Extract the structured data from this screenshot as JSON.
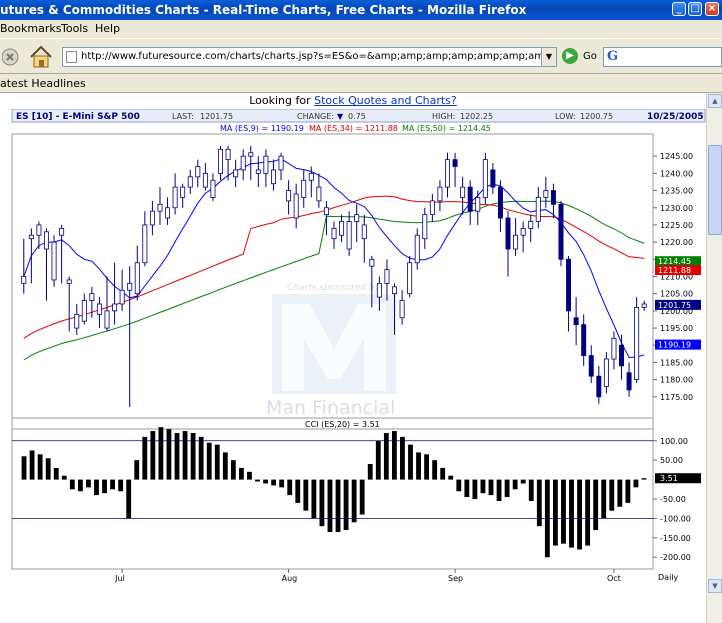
{
  "window": {
    "title": "utures & Commodities Charts - Real-Time Charts, Free Charts - Mozilla Firefox",
    "minimize": "_",
    "maximize": "□",
    "close": "×"
  },
  "menu": {
    "items": [
      "Bookmarks",
      "Tools",
      "Help"
    ]
  },
  "toolbar": {
    "url": "http://www.futuresource.com/charts/charts.jsp?s=ES&o=&amp;amp;amp;amp;amp;amp;amp;amp;a=D&",
    "go_label": "Go",
    "search_logo": "G"
  },
  "headlines": {
    "label": "atest Headlines"
  },
  "promo": {
    "prefix": "Looking for ",
    "link": "Stock Quotes and Charts?"
  },
  "chart_header": {
    "symbol": "ES [10] - E-Mini S&P 500",
    "last_label": "LAST:",
    "last": "1201.75",
    "change_label": "CHANGE:",
    "change": "0.75",
    "high_label": "HIGH:",
    "high": "1202.25",
    "low_label": "LOW:",
    "low": "1200.75",
    "date": "10/25/2005",
    "ma9_label": "MA (ES,9) = 1190.19",
    "ma34_label": "MA (ES,34) = 1211.88",
    "ma50_label": "MA (ES,50) = 1214.45",
    "cci_label": "CCI (ES,20) = 3.51",
    "sponsor": "Charts sponsored by",
    "watermark": "Man Financial",
    "period": "Daily"
  },
  "chart_data": [
    {
      "type": "candlestick",
      "title": "ES [10] - E-Mini S&P 500",
      "ylim": [
        1170,
        1250
      ],
      "y_ticks": [
        "1245.00",
        "1240.00",
        "1235.00",
        "1230.00",
        "1225.00",
        "1220.00",
        "1215.00",
        "1210.00",
        "1205.00",
        "1200.00",
        "1195.00",
        "1190.00",
        "1185.00",
        "1180.00",
        "1175.00"
      ],
      "x_labels": [
        "Jul",
        "Aug",
        "Sep",
        "Oct"
      ],
      "x_label_index": [
        13,
        35,
        57,
        78
      ],
      "value_tags": [
        {
          "value": "1214.45",
          "y": 1214.45,
          "color": "#008000"
        },
        {
          "value": "1211.88",
          "y": 1211.88,
          "color": "#e00000"
        },
        {
          "value": "1201.75",
          "y": 1201.75,
          "color": "#000080"
        },
        {
          "value": "1190.19",
          "y": 1190.19,
          "color": "#0000ff"
        }
      ],
      "candles": [
        [
          1208,
          1210,
          1205,
          1221
        ],
        [
          1221,
          1222,
          1208,
          1224
        ],
        [
          1222,
          1225,
          1218,
          1226
        ],
        [
          1218,
          1223,
          1203,
          1224
        ],
        [
          1209,
          1220,
          1207,
          1222
        ],
        [
          1222,
          1224,
          1208,
          1225
        ],
        [
          1208,
          1209,
          1194,
          1210
        ],
        [
          1195,
          1199,
          1193,
          1202
        ],
        [
          1197,
          1203,
          1196,
          1205
        ],
        [
          1203,
          1205,
          1198,
          1207
        ],
        [
          1199,
          1202,
          1195,
          1204
        ],
        [
          1195,
          1200,
          1194,
          1210
        ],
        [
          1200,
          1202,
          1196,
          1214
        ],
        [
          1202,
          1206,
          1200,
          1212
        ],
        [
          1206,
          1208,
          1172,
          1213
        ],
        [
          1205,
          1214,
          1203,
          1219
        ],
        [
          1214,
          1225,
          1213,
          1229
        ],
        [
          1225,
          1229,
          1222,
          1232
        ],
        [
          1229,
          1231,
          1225,
          1236
        ],
        [
          1227,
          1230,
          1225,
          1233
        ],
        [
          1230,
          1236,
          1228,
          1240
        ],
        [
          1233,
          1236,
          1230,
          1237
        ],
        [
          1236,
          1239,
          1234,
          1241
        ],
        [
          1239,
          1242,
          1236,
          1244
        ],
        [
          1236,
          1240,
          1235,
          1243
        ],
        [
          1233,
          1238,
          1232,
          1240
        ],
        [
          1240,
          1247,
          1238,
          1248
        ],
        [
          1244,
          1247,
          1238,
          1248
        ],
        [
          1239,
          1241,
          1236,
          1244
        ],
        [
          1241,
          1245,
          1238,
          1247
        ],
        [
          1245,
          1246,
          1238,
          1248
        ],
        [
          1240,
          1241,
          1236,
          1245
        ],
        [
          1240,
          1245,
          1236,
          1247
        ],
        [
          1237,
          1241,
          1235,
          1244
        ],
        [
          1241,
          1245,
          1238,
          1246
        ],
        [
          1232,
          1235,
          1228,
          1238
        ],
        [
          1227,
          1234,
          1224,
          1237
        ],
        [
          1233,
          1238,
          1230,
          1241
        ],
        [
          1238,
          1240,
          1233,
          1242
        ],
        [
          1232,
          1236,
          1230,
          1240
        ],
        [
          1228,
          1230,
          1222,
          1232
        ],
        [
          1221,
          1224,
          1218,
          1226
        ],
        [
          1222,
          1226,
          1220,
          1228
        ],
        [
          1218,
          1226,
          1216,
          1229
        ],
        [
          1226,
          1228,
          1220,
          1231
        ],
        [
          1221,
          1225,
          1214,
          1228
        ],
        [
          1213,
          1215,
          1201,
          1216
        ],
        [
          1204,
          1208,
          1200,
          1210
        ],
        [
          1208,
          1212,
          1203,
          1215
        ],
        [
          1205,
          1207,
          1193,
          1208
        ],
        [
          1198,
          1203,
          1196,
          1206
        ],
        [
          1205,
          1214,
          1204,
          1216
        ],
        [
          1214,
          1222,
          1212,
          1224
        ],
        [
          1221,
          1228,
          1218,
          1230
        ],
        [
          1228,
          1232,
          1226,
          1234
        ],
        [
          1232,
          1236,
          1229,
          1238
        ],
        [
          1236,
          1244,
          1233,
          1246
        ],
        [
          1244,
          1242,
          1236,
          1246
        ],
        [
          1233,
          1236,
          1228,
          1239
        ],
        [
          1236,
          1229,
          1225,
          1238
        ],
        [
          1229,
          1233,
          1225,
          1235
        ],
        [
          1233,
          1244,
          1231,
          1246
        ],
        [
          1241,
          1236,
          1234,
          1243
        ],
        [
          1236,
          1227,
          1223,
          1238
        ],
        [
          1227,
          1218,
          1210,
          1229
        ],
        [
          1218,
          1222,
          1216,
          1227
        ],
        [
          1222,
          1224,
          1217,
          1226
        ],
        [
          1224,
          1226,
          1220,
          1228
        ],
        [
          1226,
          1233,
          1224,
          1236
        ],
        [
          1233,
          1235,
          1230,
          1239
        ],
        [
          1235,
          1231,
          1227,
          1237
        ],
        [
          1231,
          1215,
          1213,
          1232
        ],
        [
          1215,
          1200,
          1194,
          1216
        ],
        [
          1198,
          1196,
          1190,
          1204
        ],
        [
          1196,
          1187,
          1184,
          1199
        ],
        [
          1187,
          1181,
          1179,
          1190
        ],
        [
          1181,
          1175,
          1173,
          1184
        ],
        [
          1178,
          1186,
          1176,
          1188
        ],
        [
          1186,
          1192,
          1183,
          1194
        ],
        [
          1190,
          1184,
          1180,
          1193
        ],
        [
          1182,
          1177,
          1175,
          1185
        ],
        [
          1180,
          1201,
          1179,
          1204
        ],
        [
          1201,
          1202,
          1200,
          1203
        ]
      ]
    },
    {
      "type": "bar",
      "title": "CCI (ES,20) = 3.51",
      "ylim": [
        -220,
        120
      ],
      "y_ticks": [
        "100.00",
        "50.00",
        "-50.00",
        "-100.00",
        "-150.00",
        "-200.00"
      ],
      "reference_lines": [
        100,
        -100
      ],
      "value_tag": "3.51",
      "values": [
        60,
        75,
        65,
        55,
        30,
        10,
        -25,
        -30,
        -20,
        -40,
        -35,
        -25,
        -30,
        -100,
        50,
        110,
        125,
        135,
        130,
        120,
        125,
        120,
        110,
        95,
        90,
        70,
        50,
        30,
        20,
        -5,
        -10,
        -15,
        -20,
        -40,
        -60,
        -80,
        -100,
        -120,
        -135,
        -135,
        -130,
        -110,
        -90,
        40,
        100,
        120,
        125,
        110,
        90,
        70,
        65,
        50,
        30,
        10,
        -30,
        -45,
        -50,
        -35,
        -40,
        -55,
        -45,
        -25,
        -10,
        -55,
        -120,
        -200,
        -170,
        -165,
        -175,
        -180,
        -170,
        -130,
        -100,
        -80,
        -70,
        -60,
        -20,
        3.51
      ]
    }
  ]
}
